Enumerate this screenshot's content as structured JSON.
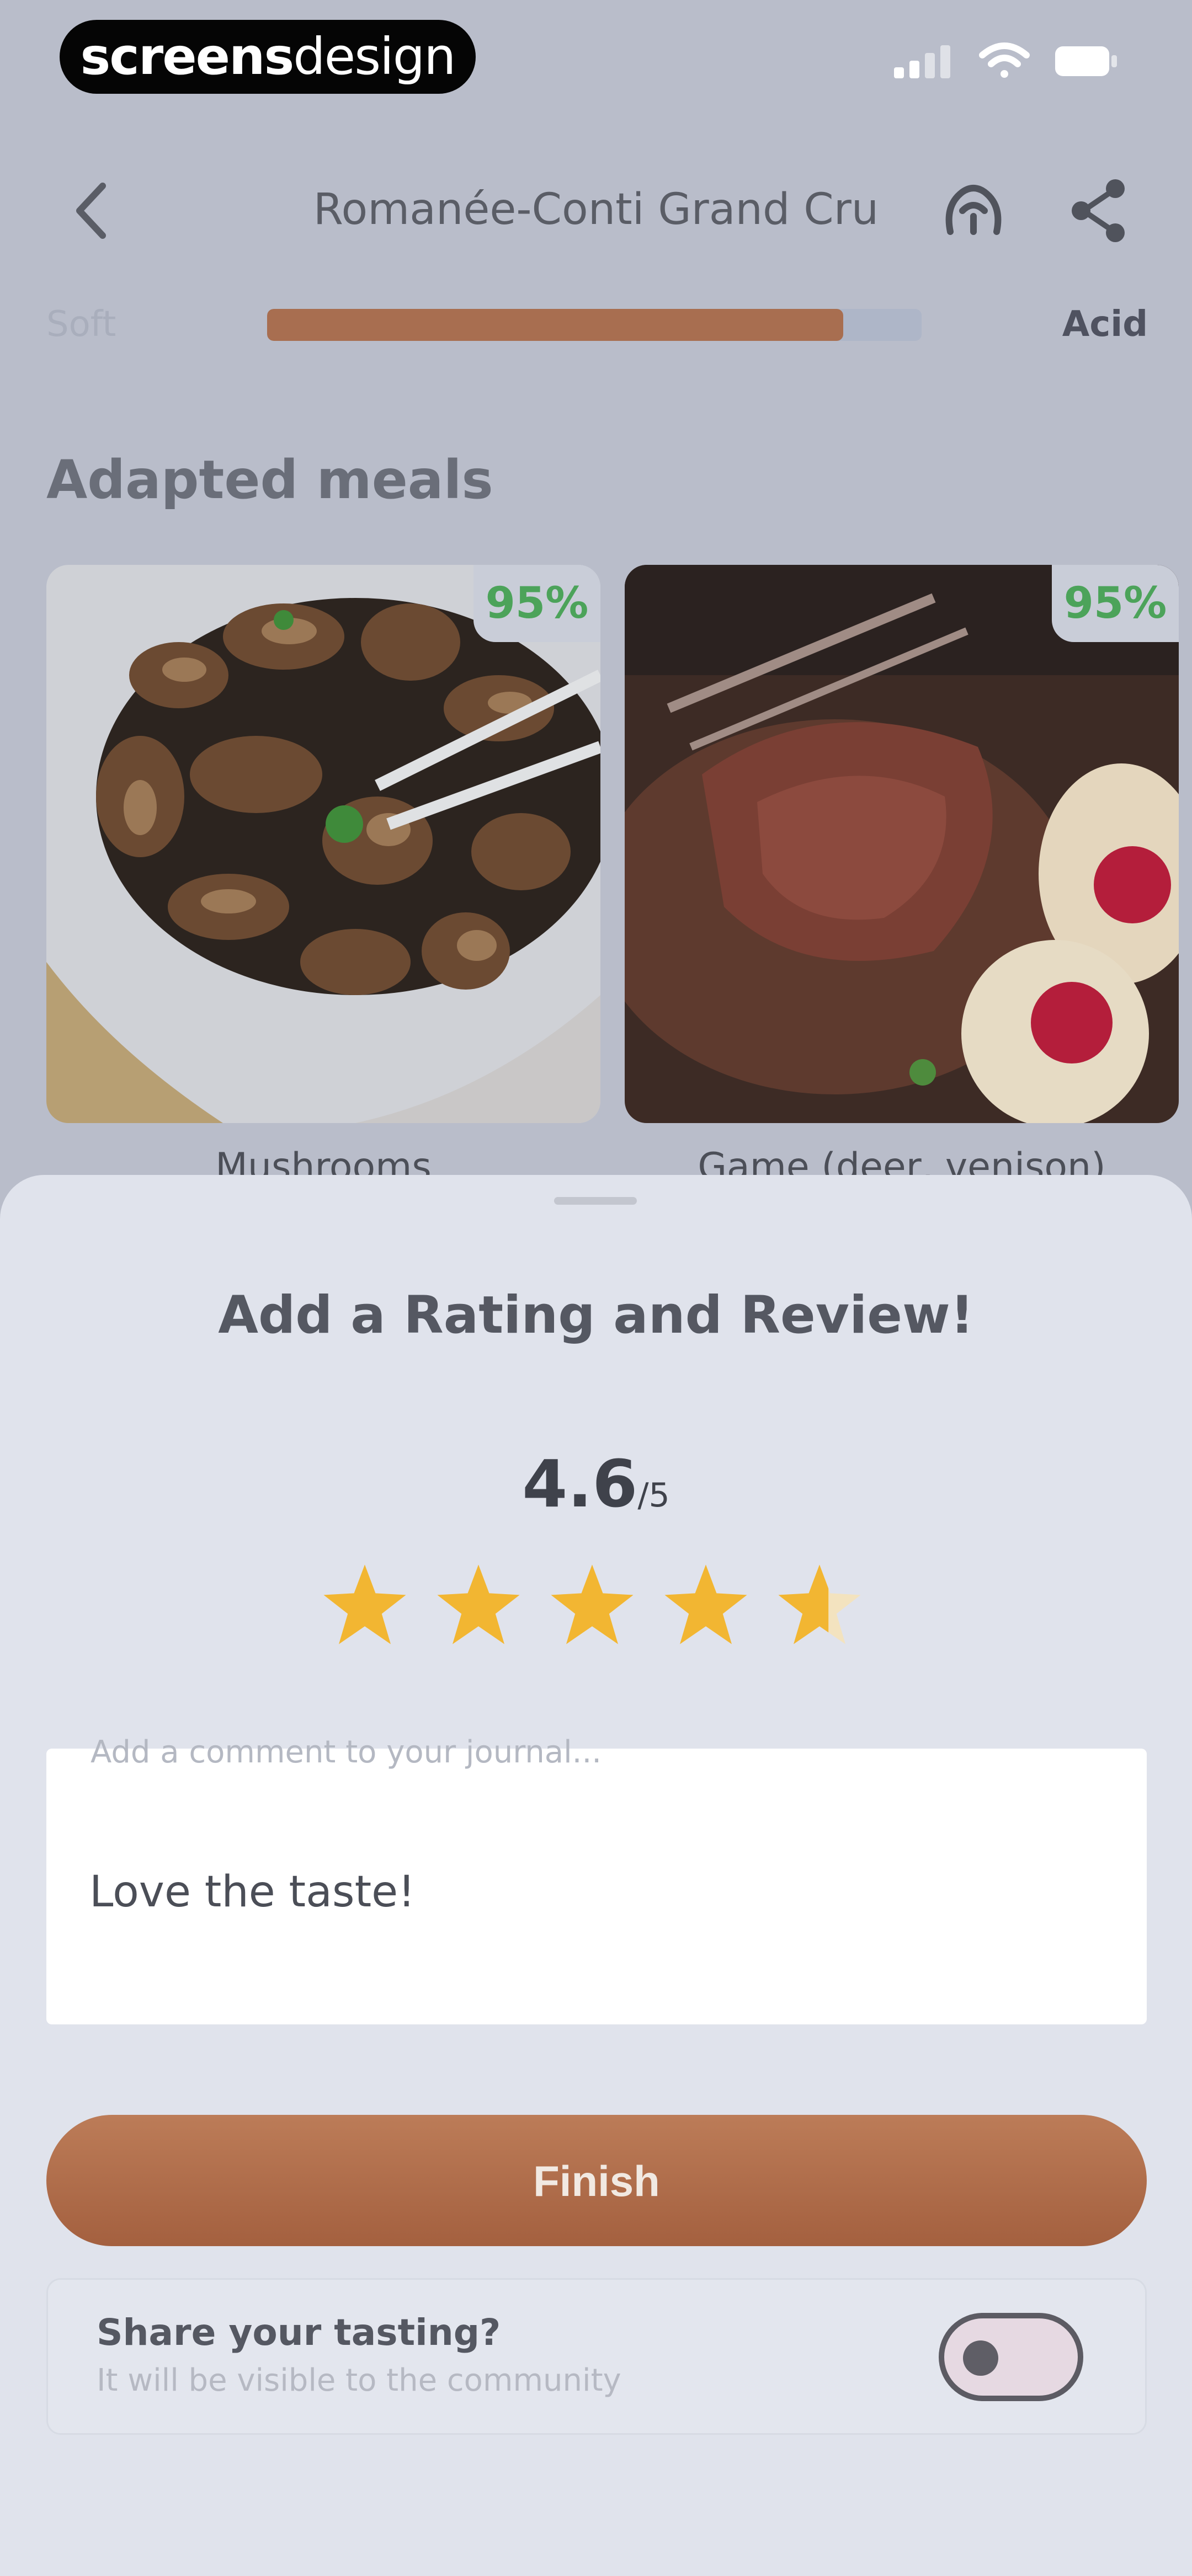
{
  "status_bar": {
    "brand_strong": "screens",
    "brand_light": "design"
  },
  "header": {
    "title": "Romanée-Conti Grand Cru",
    "back_icon": "chevron-left-icon",
    "action_icons": [
      "wine-glass-icon",
      "share-icon"
    ]
  },
  "acidity_scale": {
    "left_label": "Soft",
    "right_label": "Acid",
    "level": 0.88,
    "fill_color": "#a86e50",
    "track_color": "#aeb6c8"
  },
  "meals": {
    "title": "Adapted meals",
    "items": [
      {
        "name": "Mushrooms",
        "match": "95%"
      },
      {
        "name": "Game (deer, venison)",
        "match": "95%"
      }
    ]
  },
  "review_sheet": {
    "title": "Add a Rating and Review!",
    "rating_value": "4.6",
    "rating_max": "/5",
    "rating": 4.6,
    "star_color": "#f2b632",
    "comment_placeholder": "Add a comment to your journal...",
    "comment_value": "Love the taste!",
    "finish_label": "Finish",
    "share_title": "Share your tasting?",
    "share_subtitle": "It will be visible to the community",
    "share_enabled": false
  },
  "colors": {
    "accent": "#ad6a48",
    "match_green": "#4ca35a"
  }
}
